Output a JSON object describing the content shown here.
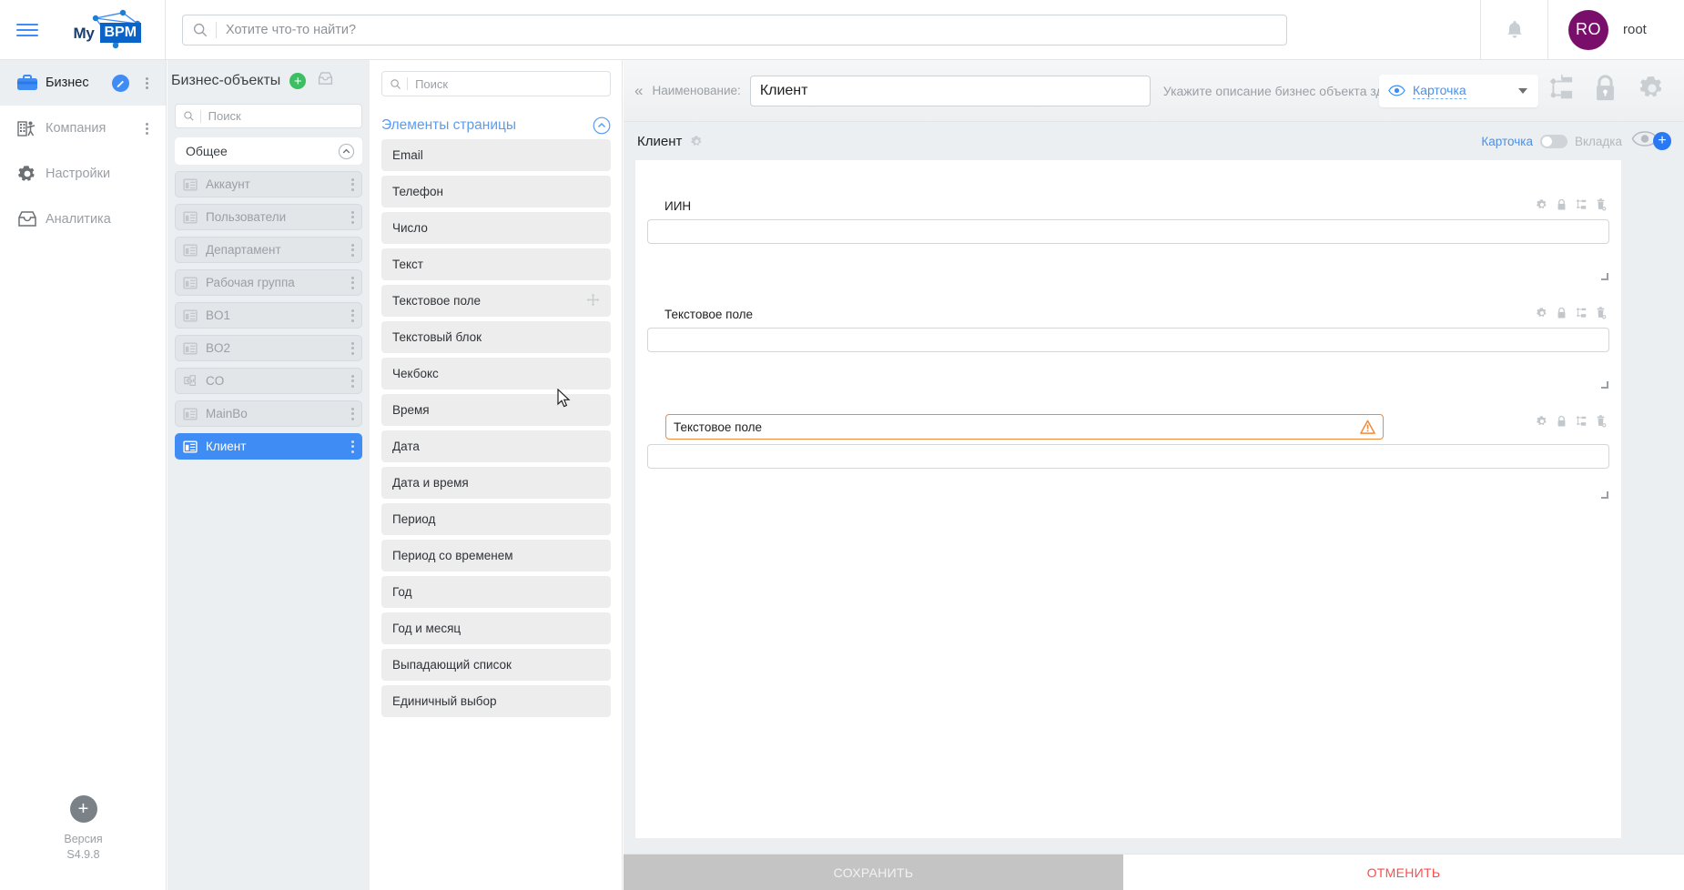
{
  "topbar": {
    "logo_my": "My",
    "logo_bpm": "BPM",
    "search_placeholder": "Хотите что-то найти?",
    "search_value": "",
    "username": "root",
    "avatar_initials": "RO"
  },
  "leftnav": {
    "items": [
      {
        "label": "Бизнес",
        "icon": "briefcase-icon",
        "active": true
      },
      {
        "label": "Компания",
        "icon": "company-icon",
        "active": false
      },
      {
        "label": "Настройки",
        "icon": "gear-icon",
        "active": false
      },
      {
        "label": "Аналитика",
        "icon": "tray-icon",
        "active": false
      }
    ],
    "version_label": "Версия",
    "version_value": "S4.9.8"
  },
  "bopanel": {
    "title": "Бизнес-объекты",
    "search_placeholder": "Поиск",
    "search_value": "",
    "group_label": "Общее",
    "items": [
      {
        "label": "Аккаунт",
        "icon": "bo-icon",
        "selected": false
      },
      {
        "label": "Пользователи",
        "icon": "bo-icon",
        "selected": false
      },
      {
        "label": "Департамент",
        "icon": "bo-icon",
        "selected": false
      },
      {
        "label": "Рабочая группа",
        "icon": "bo-icon",
        "selected": false
      },
      {
        "label": "BO1",
        "icon": "bo-icon",
        "selected": false
      },
      {
        "label": "BO2",
        "icon": "bo-icon",
        "selected": false
      },
      {
        "label": "CO",
        "icon": "co-icon",
        "selected": false
      },
      {
        "label": "MainBo",
        "icon": "bo-icon",
        "selected": false
      },
      {
        "label": "Клиент",
        "icon": "bo-icon",
        "selected": true
      }
    ]
  },
  "elements_panel": {
    "search_placeholder": "Поиск",
    "search_value": "",
    "section_title": "Элементы страницы",
    "items": [
      {
        "label": "Email"
      },
      {
        "label": "Телефон"
      },
      {
        "label": "Число"
      },
      {
        "label": "Текст"
      },
      {
        "label": "Текстовое поле",
        "dragging": true
      },
      {
        "label": "Текстовый блок"
      },
      {
        "label": "Чекбокс"
      },
      {
        "label": "Время"
      },
      {
        "label": "Дата"
      },
      {
        "label": "Дата и время"
      },
      {
        "label": "Период"
      },
      {
        "label": "Период со временем"
      },
      {
        "label": "Год"
      },
      {
        "label": "Год и месяц"
      },
      {
        "label": "Выпадающий список"
      },
      {
        "label": "Единичный выбор"
      }
    ]
  },
  "editor_bar": {
    "name_label": "Наименование:",
    "name_value": "Клиент",
    "description_placeholder": "Укажите описание бизнес объекта здесь",
    "description_value": "",
    "view_selected": "Карточка"
  },
  "canvas": {
    "title": "Клиент",
    "toggle_left": "Карточка",
    "toggle_right": "Вкладка",
    "toggle_on": false,
    "fields": [
      {
        "label": "ИИН",
        "value": "",
        "selected": false
      },
      {
        "label": "Текстовое поле",
        "value": "",
        "selected": false
      },
      {
        "label": "Текстовое поле",
        "value": "",
        "selected": true,
        "warning": true
      }
    ],
    "save_label": "СОХРАНИТЬ",
    "cancel_label": "ОТМЕНИТЬ"
  },
  "colors": {
    "accent_blue": "#3f8cf5",
    "link_blue": "#5b9cf0",
    "selection_orange": "#f08a3c",
    "cancel_red": "#ff4b4b",
    "avatar_purple": "#7a0f6b",
    "add_green": "#3bbf62"
  }
}
